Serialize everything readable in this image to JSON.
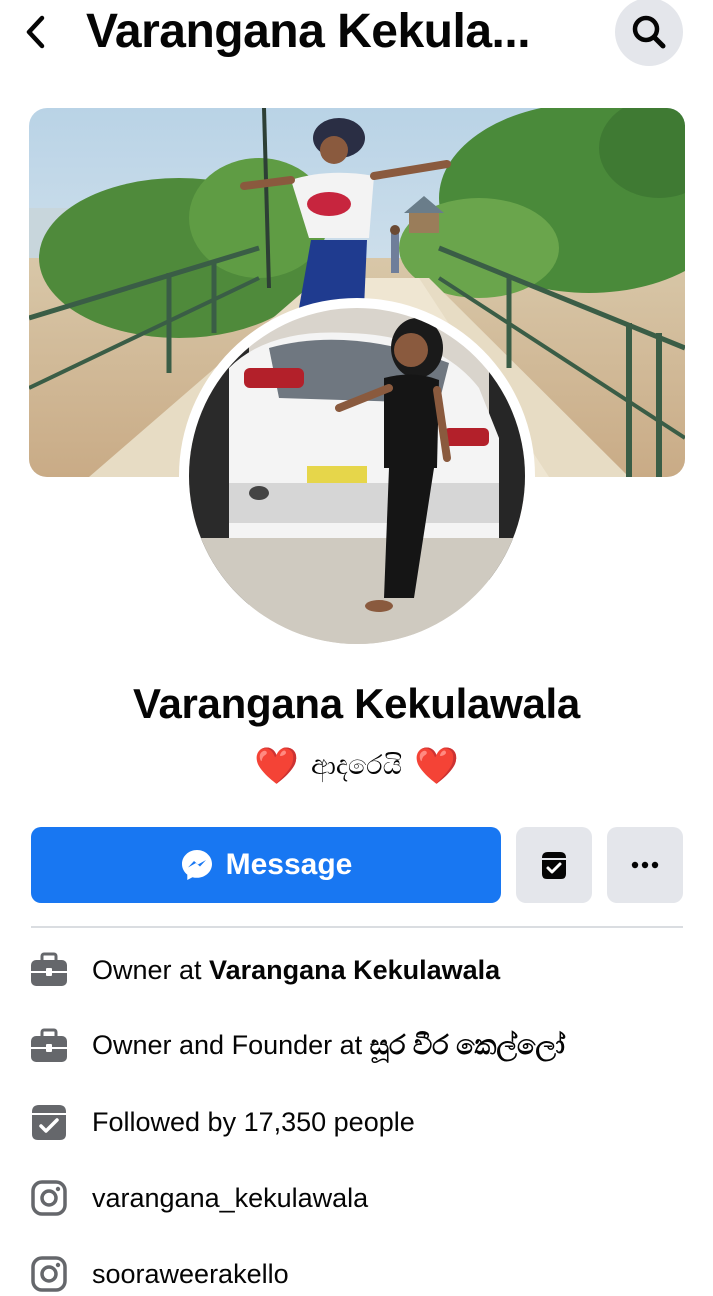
{
  "header": {
    "title": "Varangana Kekula...",
    "back_icon": "chevron-left-icon",
    "search_icon": "search-icon"
  },
  "profile": {
    "name": "Varangana Kekulawala",
    "bio_text": "ආදරෙයි",
    "bio_left_emoji": "❤️",
    "bio_right_emoji": "❤️"
  },
  "actions": {
    "message_label": "Message",
    "message_icon": "messenger-icon",
    "follow_icon": "following-icon",
    "more_icon": "more-horizontal-icon",
    "accent_color": "#1877f2"
  },
  "details": [
    {
      "icon": "briefcase-icon",
      "prefix": "Owner at ",
      "bold": "Varangana Kekulawala"
    },
    {
      "icon": "briefcase-icon",
      "prefix": "Owner and Founder at ",
      "bold": "සූර වීර කෙල්ලෝ"
    },
    {
      "icon": "followed-icon",
      "prefix": "Followed by 17,350 people",
      "bold": ""
    },
    {
      "icon": "instagram-icon",
      "prefix": "varangana_kekulawala",
      "bold": ""
    },
    {
      "icon": "instagram-icon",
      "prefix": "sooraweerakello",
      "bold": ""
    }
  ]
}
